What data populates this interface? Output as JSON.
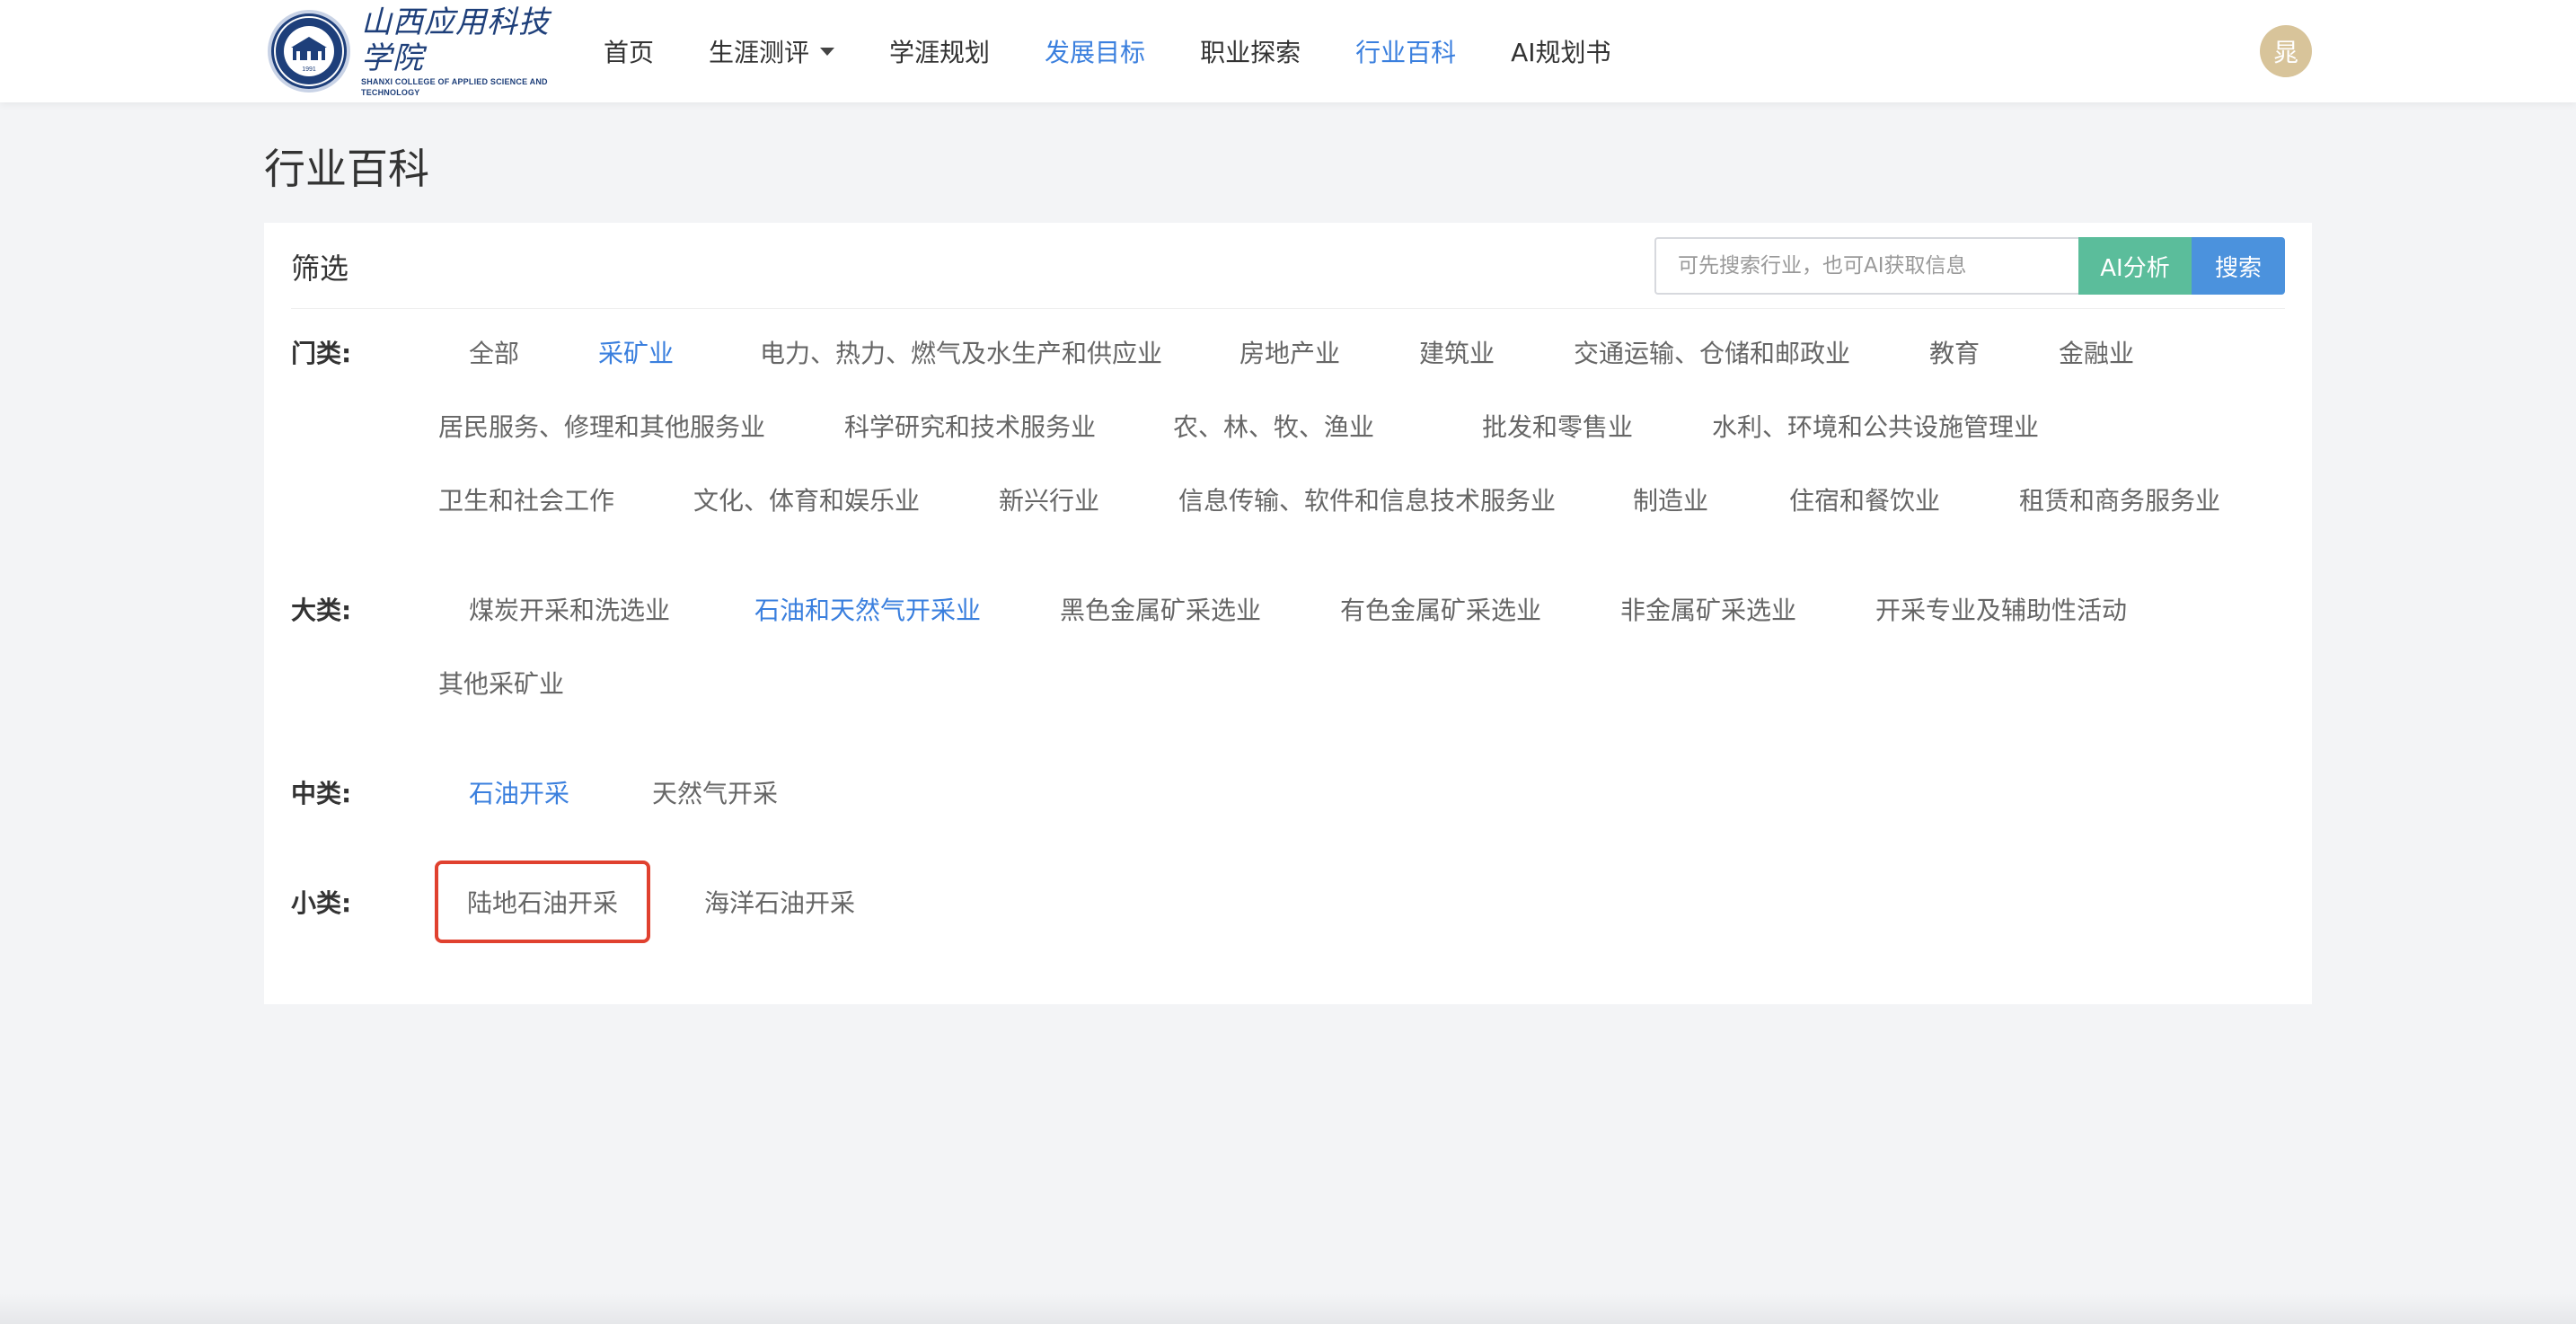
{
  "header": {
    "logo": {
      "name_cn": "山西应用科技学院",
      "name_en": "SHANXI COLLEGE OF APPLIED SCIENCE AND TECHNOLOGY",
      "emblem_year": "1991"
    },
    "nav": [
      {
        "label": "首页"
      },
      {
        "label": "生涯测评"
      },
      {
        "label": "学涯规划"
      },
      {
        "label": "发展目标"
      },
      {
        "label": "职业探索"
      },
      {
        "label": "行业百科"
      },
      {
        "label": "AI规划书"
      }
    ],
    "avatar_text": "晁"
  },
  "page": {
    "title": "行业百科"
  },
  "filter": {
    "title": "筛选",
    "search_placeholder": "可先搜索行业，也可AI获取信息",
    "ai_button": "AI分析",
    "search_button": "搜索"
  },
  "categories": {
    "label": "门类:",
    "items": [
      "全部",
      "采矿业",
      "电力、热力、燃气及水生产和供应业",
      "房地产业",
      "建筑业",
      "交通运输、仓储和邮政业",
      "教育",
      "金融业",
      "居民服务、修理和其他服务业",
      "科学研究和技术服务业",
      "农、林、牧、渔业",
      "批发和零售业",
      "水利、环境和公共设施管理业",
      "卫生和社会工作",
      "文化、体育和娱乐业",
      "新兴行业",
      "信息传输、软件和信息技术服务业",
      "制造业",
      "住宿和餐饮业",
      "租赁和商务服务业"
    ]
  },
  "major": {
    "label": "大类:",
    "items": [
      "煤炭开采和洗选业",
      "石油和天然气开采业",
      "黑色金属矿采选业",
      "有色金属矿采选业",
      "非金属矿采选业",
      "开采专业及辅助性活动",
      "其他采矿业"
    ]
  },
  "medium": {
    "label": "中类:",
    "items": [
      "石油开采",
      "天然气开采"
    ]
  },
  "minor": {
    "label": "小类:",
    "items": [
      "陆地石油开采",
      "海洋石油开采"
    ]
  },
  "colors": {
    "accent": "#3a7fde",
    "ai_button": "#5bbd9b",
    "search_button": "#4b92dd",
    "highlight_border": "#e0412f"
  }
}
